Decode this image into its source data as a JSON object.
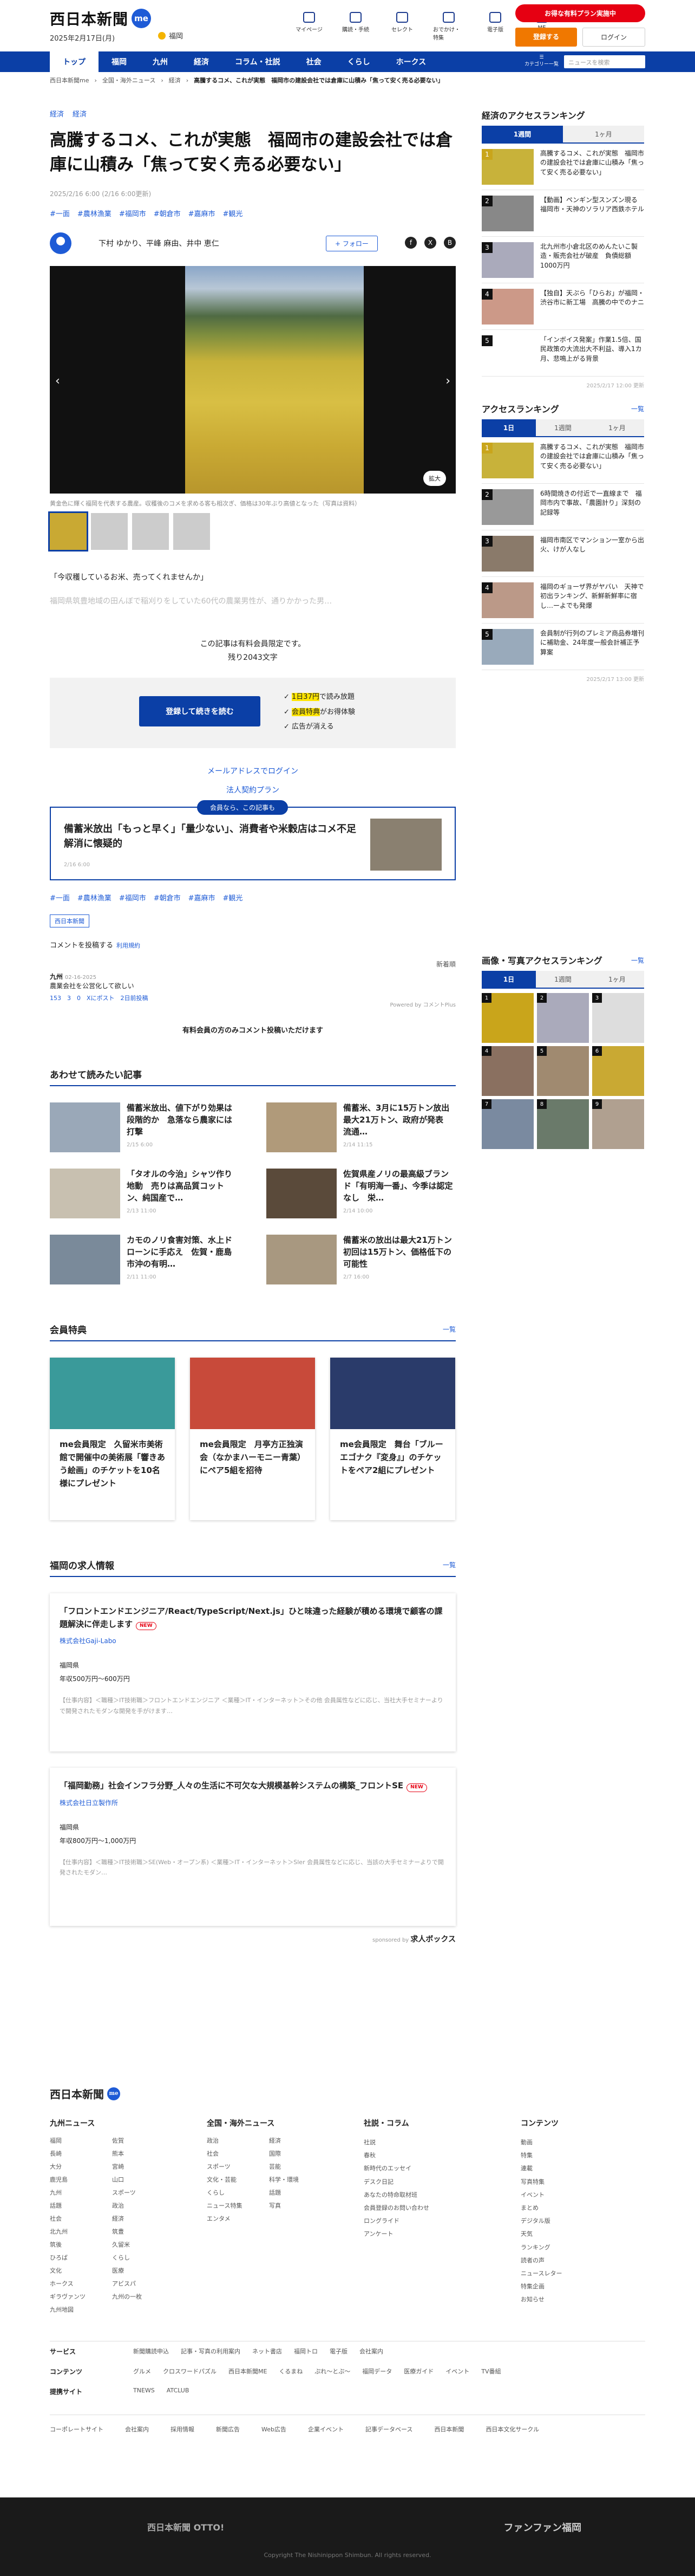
{
  "header": {
    "logo": "西日本新聞",
    "me": "me",
    "date": "2025年2月17日(月)",
    "weather": "福岡",
    "icons": [
      {
        "label": "マイページ",
        "icon": "user-icon"
      },
      {
        "label": "購読・手続",
        "icon": "newspaper-icon"
      },
      {
        "label": "セレクト",
        "icon": "select-icon"
      },
      {
        "label": "おでかけ・特集",
        "icon": "outing-icon"
      },
      {
        "label": "電子版",
        "icon": "digital-icon"
      },
      {
        "label": "ME",
        "icon": "menu-icon"
      }
    ],
    "promo": "お得な有料プラン実施中",
    "register": "登録する",
    "login": "ログイン"
  },
  "nav": {
    "items": [
      "トップ",
      "福岡",
      "九州",
      "経済",
      "コラム・社説",
      "社会",
      "くらし",
      "ホークス"
    ],
    "search_placeholder": "ニュースを検索",
    "menu_label": "カテゴリー一覧"
  },
  "breadcrumb": [
    "西日本新聞me",
    "全国・海外ニュース",
    "経済",
    "高騰するコメ、これが実態　福岡市の建設会社では倉庫に山積み「焦って安く売る必要ない」"
  ],
  "article": {
    "categories": [
      "経済",
      "経済"
    ],
    "title": "高騰するコメ、これが実態　福岡市の建設会社では倉庫に山積み「焦って安く売る必要ない」",
    "date": "2025/2/16 6:00 (2/16 6:00更新)",
    "tags": [
      "#一面",
      "#農林漁業",
      "#福岡市",
      "#朝倉市",
      "#嘉麻市",
      "#観光"
    ],
    "authors": "下村 ゆかり、平峰 麻由、井中 恵仁",
    "follow": "+ フォロー",
    "social": [
      "f",
      "X",
      "B"
    ],
    "zoom": "拡大",
    "caption": "黄金色に輝く福岡を代表する農産。収穫後のコメを求める客も相次ぎ、価格は30年ぶり高値となった（写真は資料）",
    "quote": "「今収穫しているお米、売ってくれませんか」",
    "fade": "福岡県筑豊地域の田んぼで稲刈りをしていた60代の農業男性が、通りかかった男…",
    "paid1": "この記事は有料会員限定です。",
    "paid2": "残り2043文字",
    "cta": "登録して続きを読む",
    "benefits": [
      {
        "pre": "",
        "hl": "1日37円",
        "post": "で読み放題"
      },
      {
        "pre": "",
        "hl": "会員特典",
        "post": "がお得体験"
      },
      {
        "pre": "",
        "hl": "",
        "post": "広告が消える"
      }
    ],
    "login_link": "メールアドレスでログイン",
    "corp_link": "法人契約プラン",
    "rec_label": "会員なら、この記事も",
    "rec_title": "備蓄米放出「もっと早く」「量少ない」、消費者や米穀店はコメ不足解消に懐疑的",
    "rec_meta": "2/16 6:00",
    "tags2": [
      "#一面",
      "#農林漁業",
      "#福岡市",
      "#朝倉市",
      "#嘉麻市",
      "#観光"
    ],
    "source": "西日本新聞",
    "comment_prompt": "コメントを投稿する",
    "comment_rule": "利用規約",
    "sort": "新着順",
    "comment": {
      "name": "九州",
      "sub": "02-16-2025",
      "text": "農業会社を公営化して欲しい",
      "reactions": "153　3　0　Xにポスト　2日前投稿"
    },
    "powered": "Powered by コメントPlus",
    "limit": "有料会員の方のみコメント投稿いただけます"
  },
  "related": {
    "title": "あわせて読みたい記事",
    "items": [
      {
        "title": "備蓄米放出、値下がり効果は段階的か　急落なら農家には打撃",
        "meta": "2/15 6:00"
      },
      {
        "title": "備蓄米、3月に15万トン放出　最大21万トン、政府が発表　流通…",
        "meta": "2/14 11:15"
      },
      {
        "title": "「タオルの今治」シャツ作り地動　売りは高品質コットン、純国産で…",
        "meta": "2/13 11:00"
      },
      {
        "title": "佐賀県産ノリの最高級ブランド「有明海一番」、今季は認定なし　栄…",
        "meta": "2/14 10:00"
      },
      {
        "title": "カモのノリ食害対策、水上ドローンに手応え　佐賀・鹿島市沖の有明…",
        "meta": "2/11 11:00"
      },
      {
        "title": "備蓄米の放出は最大21万トン　初回は15万トン、価格低下の可能性",
        "meta": "2/7 16:00"
      }
    ]
  },
  "benefits": {
    "title": "会員特典",
    "more": "一覧",
    "items": [
      {
        "title": "me会員限定　久留米市美術館で開催中の美術展「響きあう絵画」のチケットを10名様にプレゼント",
        "color": "#3a9a9a"
      },
      {
        "title": "me会員限定　月亭方正独演会（なかまハーモニー青葉）にペア5組を招待",
        "color": "#c84a3a"
      },
      {
        "title": "me会員限定　舞台「ブルーエゴナク『変身』」のチケットをペア2組にプレゼント",
        "color": "#2a3b6a"
      }
    ]
  },
  "jobs": {
    "title": "福岡の求人情報",
    "more": "一覧",
    "items": [
      {
        "title": "「フロントエンドエンジニア/React/TypeScript/Next.js」ひと味違った経験が積める環境で顧客の課題解決に伴走します",
        "new": "NEW",
        "company": "株式会社Gaji-Labo",
        "loc": "福岡県",
        "salary": "年収500万円〜600万円",
        "desc": "【仕事内容】＜職種＞IT技術職＞フロントエンドエンジニア ＜業種＞IT・インターネット＞その他 会員属性などに応じ、当社大手セミナーよりで開発されたモダンな開発を手がけます…"
      },
      {
        "title": "「福岡勤務」社会インフラ分野_人々の生活に不可欠な大規模基幹システムの構築_フロントSE",
        "new": "NEW",
        "company": "株式会社日立製作所",
        "loc": "福岡県",
        "salary": "年収800万円〜1,000万円",
        "desc": "【仕事内容】＜職種＞IT技術職＞SE(Web・オープン系) ＜業種＞IT・インターネット＞Sler 会員属性などに応じ、当該の大手セミナーよりで開発されたモダン…"
      }
    ],
    "sponsor": "求人ボックス"
  },
  "side": {
    "econ_title": "経済のアクセスランキング",
    "econ_tabs": [
      "1週間",
      "1ヶ月"
    ],
    "econ": [
      "高騰するコメ、これが実態　福岡市の建設会社では倉庫に山積み「焦って安く売る必要ない」",
      "【動画】ペンギン型スンズン現る　福岡市・天神のソラリア西鉄ホテル",
      "北九州市小倉北区のめんたいこ製造・販売会社が破産　負債総額1000万円",
      "【独自】天ぷら「ひらお」が福岡・渋谷市に新工場　高騰の中でのナニ",
      "「インボイス発案」作業1.5倍、国民政策の大流出大不利益、導入1カ月、悲鳴上がる背景"
    ],
    "econ_date": "2025/2/17 12:00 更新",
    "all_title": "アクセスランキング",
    "all_more": "一覧",
    "all_tabs": [
      "1日",
      "1週間",
      "1ヶ月"
    ],
    "all": [
      "高騰するコメ、これが実態　福岡市の建設会社では倉庫に山積み「焦って安く売る必要ない」",
      "6時間焼きの付近で一直線まで　福岡市内で事故、「農園計り」深刻の記録等",
      "福岡市南区でマンション一室から出火、けが人なし",
      "福岡のギョーザ界がヤバい　天神で初出ランキング、新鮮新鮮率に宿し…ーよでも発爆",
      "会員制が行列のプレミア商品券増刊に補助金、24年度一般会計補正予算案"
    ],
    "all_date": "2025/2/17 13:00 更新",
    "photo_title": "画像・写真アクセスランキング",
    "photo_more": "一覧",
    "photo_tabs": [
      "1日",
      "1週間",
      "1ヶ月"
    ],
    "photo_nums": [
      "1",
      "2",
      "3",
      "4",
      "5",
      "6",
      "7",
      "8",
      "9"
    ]
  },
  "footer": {
    "logo": "西日本新聞",
    "cols": [
      {
        "title": "九州ニュース",
        "items": [
          "福岡",
          "佐賀",
          "長崎",
          "熊本",
          "大分",
          "宮崎",
          "鹿児島",
          "山口",
          "九州",
          "スポーツ",
          "話題",
          "政治",
          "社会",
          "経済",
          "北九州",
          "筑豊",
          "筑後",
          "久留米",
          "ひろば",
          "くらし",
          "文化",
          "医療",
          "ホークス",
          "アビスパ",
          "ギラヴァンツ",
          "九州の一枚",
          "九州地図"
        ]
      },
      {
        "title": "全国・海外ニュース",
        "items": [
          "政治",
          "経済",
          "社会",
          "国際",
          "スポーツ",
          "芸能",
          "文化・芸能",
          "科学・環境",
          "くらし",
          "話題",
          "ニュース特集",
          "写真",
          "エンタメ"
        ]
      },
      {
        "title": "社説・コラム",
        "items": [
          "社説",
          "春秋",
          "新時代のエッセイ",
          "デスク日記",
          "あなたの特命取材班",
          "会員登録のお問い合わせ",
          "ロングライド",
          "アンケート"
        ]
      },
      {
        "title": "コンテンツ",
        "items": [
          "動画",
          "特集",
          "連載",
          "写真特集",
          "イベント",
          "まとめ",
          "デジタル版",
          "天気",
          "ランキング",
          "読者の声",
          "ニュースレター",
          "特集企画",
          "お知らせ"
        ]
      }
    ],
    "service": [
      "新聞購読申込",
      "記事・写真の利用案内",
      "ネット書店",
      "福岡トロ",
      "電子版",
      "会社案内"
    ],
    "contents": [
      "グルメ",
      "クロスワードパズル",
      "西日本新聞ME",
      "くるまね",
      "ぷれ〜とぷ〜",
      "福岡データ",
      "医療ガイド",
      "イベント",
      "TV番組"
    ],
    "related": [
      "TNEWS",
      "ATCLUB"
    ],
    "bottom": [
      "コーポレートサイト",
      "会社案内",
      "採用情報",
      "新聞広告",
      "Web広告",
      "企業イベント",
      "記事データベース",
      "西日本新聞",
      "西日本文化サークル"
    ],
    "dark_left": "西日本新聞 OTTO!",
    "dark_right": "ファンファン福岡",
    "copyright": "Copyright The Nishinippon Shimbun. All rights reserved."
  }
}
